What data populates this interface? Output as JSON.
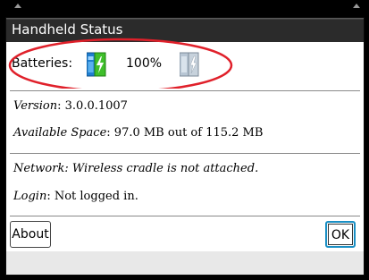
{
  "dialog": {
    "title": "Handheld Status"
  },
  "battery": {
    "label": "Batteries:",
    "percent": "100%",
    "main_icon": "battery-charging-icon",
    "backup_icon": "backup-battery-icon",
    "highlight_color": "#e0202a"
  },
  "info": {
    "version_key": "Version",
    "version_value": ": 3.0.0.1007",
    "space_key": "Available Space",
    "space_value": ": 97.0 MB out of 115.2 MB",
    "network_key": "Network",
    "network_value": ": Wireless cradle is not attached.",
    "login_key": "Login",
    "login_value": ": Not logged in."
  },
  "buttons": {
    "about": "About",
    "ok": "OK"
  },
  "colors": {
    "titlebar": "#2b2b2b",
    "battery_green": "#3fbf2a",
    "battery_blue": "#1f7fd0",
    "focus": "#1a8fc4"
  }
}
